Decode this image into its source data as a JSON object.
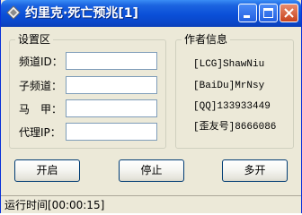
{
  "window": {
    "title": "约里克·死亡预兆[1]",
    "icon": "app-icon",
    "controls": [
      "minimize-icon",
      "maximize-icon",
      "close-icon"
    ]
  },
  "settings": {
    "legend": "设置区",
    "fields": [
      {
        "label": "频道ID：",
        "value": ""
      },
      {
        "label": "子频道：",
        "value": ""
      },
      {
        "label": "马　甲：",
        "value": ""
      },
      {
        "label": "代理IP：",
        "value": ""
      }
    ]
  },
  "author": {
    "legend": "作者信息",
    "lines": [
      "[LCG]ShawNiu",
      "[BaiDu]MrNsy",
      "[QQ]133933449",
      "[歪友号]8666086"
    ]
  },
  "buttons": {
    "start": "开启",
    "stop": "停止",
    "multi": "多开"
  },
  "status": {
    "text": "运行时间[00:00:15]"
  },
  "colors": {
    "titlebar": "#0a4fd8",
    "window_bg": "#ece9d8",
    "close_button": "#c8431d"
  }
}
